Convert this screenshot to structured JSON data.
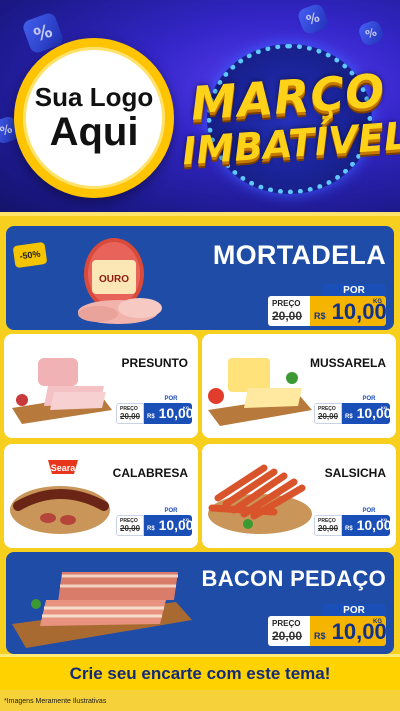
{
  "header": {
    "logo_line1": "Sua Logo",
    "logo_line2": "Aqui",
    "title_line1": "MARÇO",
    "title_line2": "IMBATÍVEL",
    "deco_symbol": "%"
  },
  "featured": {
    "badge": "-50%",
    "brand_label": "OURO",
    "title": "MORTADELA",
    "por_label": "POR",
    "preco_label": "PREÇO",
    "old_price": "20,00",
    "currency": "R$",
    "price": "10,00",
    "unit": "KG"
  },
  "products": [
    {
      "name": "PRESUNTO",
      "por_label": "POR",
      "preco_label": "PREÇO",
      "old_price": "20,00",
      "currency": "R$",
      "price": "10,00",
      "unit": "KG"
    },
    {
      "name": "MUSSARELA",
      "por_label": "POR",
      "preco_label": "PREÇO",
      "old_price": "20,00",
      "currency": "R$",
      "price": "10,00",
      "unit": "KG"
    },
    {
      "name": "CALABRESA",
      "brand_label": "Seara",
      "por_label": "POR",
      "preco_label": "PREÇO",
      "old_price": "20,00",
      "currency": "R$",
      "price": "10,00",
      "unit": "KG"
    },
    {
      "name": "SALSICHA",
      "por_label": "POR",
      "preco_label": "PREÇO",
      "old_price": "20,00",
      "currency": "R$",
      "price": "10,00",
      "unit": "KG"
    }
  ],
  "bacon": {
    "title": "BACON PEDAÇO",
    "por_label": "POR",
    "preco_label": "PREÇO",
    "old_price": "20,00",
    "currency": "R$",
    "price": "10,00",
    "unit": "KG"
  },
  "footer": {
    "cta": "Crie seu encarte com este tema!",
    "note": "*Imagens Meramente Ilustrativas"
  },
  "colors": {
    "background": "#1b1f86",
    "panel": "#f7cf1f",
    "card_blue": "#1e4ca6",
    "price_yellow": "#f4b400",
    "price_blue": "#1a4fb8"
  }
}
